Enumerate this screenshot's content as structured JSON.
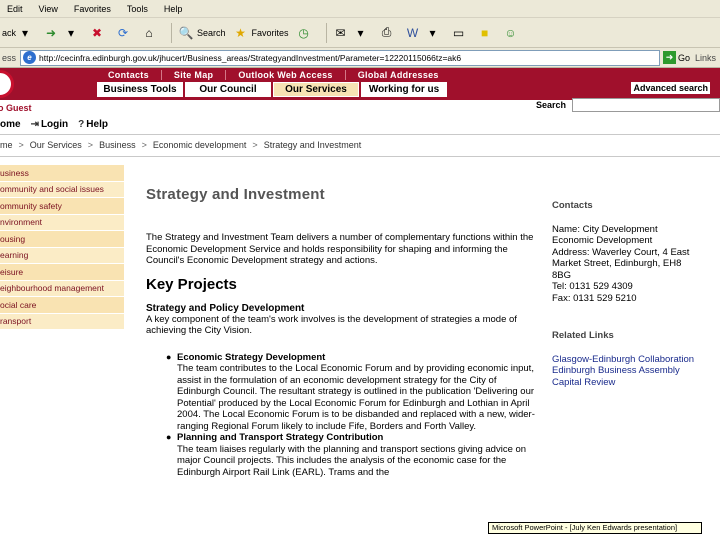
{
  "browser": {
    "menu": [
      "Edit",
      "View",
      "Favorites",
      "Tools",
      "Help"
    ],
    "toolbar": {
      "back_label": "ack",
      "search_label": "Search",
      "favorites_label": "Favorites"
    },
    "address_label": "ess",
    "address_url": "http://cecinfra.edinburgh.gov.uk/jhucert/Business_areas/StrategyandInvestment/Parameter=12220115066tz=ak6",
    "go_label": "Go",
    "links_label": "Links"
  },
  "site": {
    "top_links": [
      "Contacts",
      "Site Map",
      "Outlook Web Access",
      "Global Addresses"
    ],
    "tabs": [
      "Business Tools",
      "Our Council",
      "Our Services",
      "Working for us"
    ],
    "active_tab": "Our Services",
    "guest_label": "o Guest",
    "advanced_search": "Advanced search",
    "search_label": "Search",
    "home_label": "ome",
    "login_label": "Login",
    "help_label": "Help"
  },
  "breadcrumb": [
    "me",
    "Our Services",
    "Business",
    "Economic development",
    "Strategy and Investment"
  ],
  "leftnav": [
    "usiness",
    "ommunity and social issues",
    "ommunity safety",
    "nvironment",
    "ousing",
    "earning",
    "eisure",
    "eighbourhood management",
    "ocial care",
    "ransport"
  ],
  "main": {
    "title": "Strategy and Investment",
    "intro": "The Strategy and Investment Team delivers a number of complementary functions within the Economic Development Service and holds responsibility for shaping and informing the Council's Economic Development strategy and actions.",
    "key_projects": "Key Projects",
    "sub_title": "Strategy and Policy Development",
    "sub_text": "A key component of the team's work involves is the development of strategies a mode of achieving the City Vision.",
    "projects": [
      {
        "title": "Economic Strategy Development",
        "text": "The team contributes to the Local Economic Forum and by providing economic input, assist in the formulation of an economic development strategy for the City of Edinburgh Council. The resultant strategy is outlined in the publication 'Delivering our Potential' produced by the Local Economic Forum for Edinburgh and Lothian in April 2004. The Local Economic Forum is to be disbanded and replaced with a new, wider-ranging Regional Forum likely to include Fife, Borders and Forth Valley."
      },
      {
        "title": "Planning and Transport Strategy Contribution",
        "text": "The team liaises regularly with the planning and transport sections giving advice on major Council projects. This includes the analysis of the economic case for the Edinburgh Airport Rail Link (EARL). Trams and the"
      }
    ]
  },
  "right": {
    "contacts_heading": "Contacts",
    "contact_lines": [
      "Name: City Development",
      "Economic Development",
      "Address: Waverley Court, 4 East",
      "Market Street, Edinburgh, EH8",
      "8BG",
      "Tel: 0131 529 4309",
      "Fax: 0131 529 5210"
    ],
    "related_heading": "Related Links",
    "related_links": [
      "Glasgow-Edinburgh Collaboration",
      "Edinburgh Business Assembly",
      "Capital Review"
    ]
  },
  "status": {
    "tooltip": "Microsoft PowerPoint - [July Ken Edwards presentation]"
  },
  "colors": {
    "header_red": "#a0102c",
    "nav_bg": "#f9e3b2",
    "link_blue": "#1a2b8c"
  }
}
